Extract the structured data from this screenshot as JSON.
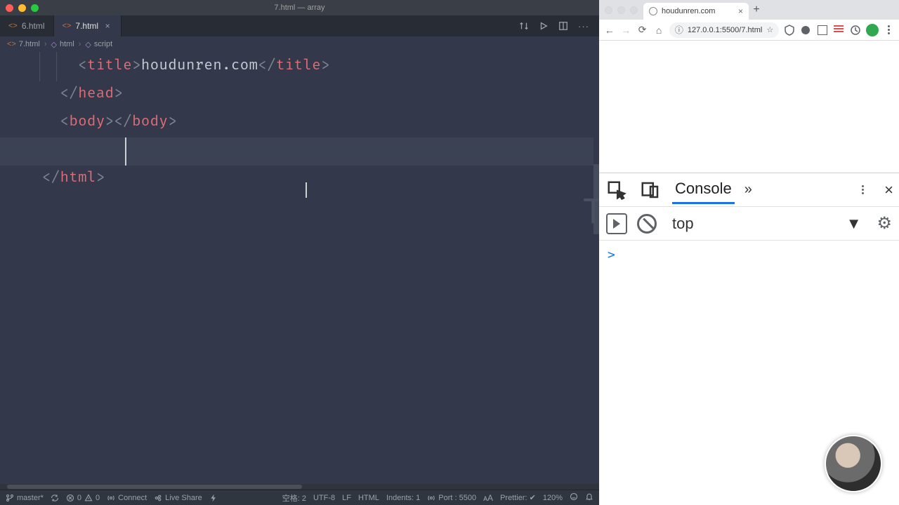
{
  "editor": {
    "window_title": "7.html — array",
    "tabs": [
      {
        "label": "6.html",
        "active": false
      },
      {
        "label": "7.html",
        "active": true
      }
    ],
    "breadcrumb": [
      "7.html",
      "html",
      "script"
    ],
    "toolbar_icons": [
      "compare-icon",
      "play-icon",
      "split-icon",
      "more-icon"
    ],
    "statusbar_left": {
      "branch": "master*",
      "errors": "0",
      "warnings": "0",
      "connect": "Connect",
      "live_share": "Live Share"
    },
    "statusbar_right": {
      "spaces": "空格: 2",
      "encoding": "UTF-8",
      "eol": "LF",
      "language": "HTML",
      "indents": "Indents: 1",
      "port": "Port : 5500",
      "prettier": "Prettier: ✔",
      "zoom": "120%"
    }
  },
  "code": {
    "title_text": "houdunren.com"
  },
  "browser": {
    "tab_title": "houdunren.com",
    "url": "127.0.0.1:5500/7.html"
  },
  "devtools": {
    "tab_label": "Console",
    "context": "top",
    "prompt": ">"
  }
}
